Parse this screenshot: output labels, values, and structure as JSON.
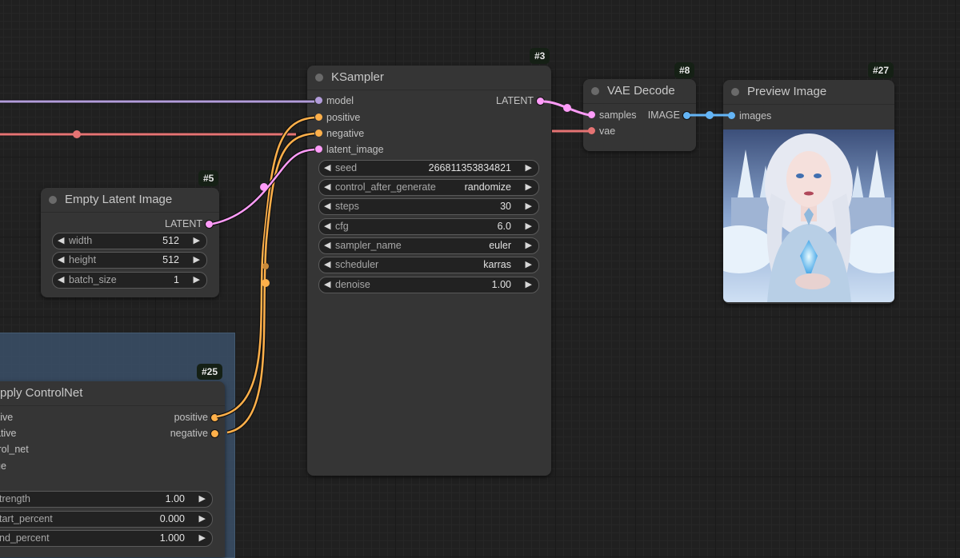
{
  "canvas": {
    "link_colors": {
      "model": "#b39ddb",
      "vae": "#ff6e6e",
      "conditioning": "#ffb04a",
      "latent": "#ff9cf9",
      "image": "#64b5f6"
    }
  },
  "nodes": {
    "ksampler": {
      "id_badge": "#3",
      "title": "KSampler",
      "inputs": [
        "model",
        "positive",
        "negative",
        "latent_image"
      ],
      "outputs": [
        "LATENT"
      ],
      "widgets": [
        {
          "label": "seed",
          "value": "266811353834821"
        },
        {
          "label": "control_after_generate",
          "value": "randomize"
        },
        {
          "label": "steps",
          "value": "30"
        },
        {
          "label": "cfg",
          "value": "6.0"
        },
        {
          "label": "sampler_name",
          "value": "euler"
        },
        {
          "label": "scheduler",
          "value": "karras"
        },
        {
          "label": "denoise",
          "value": "1.00"
        }
      ]
    },
    "vae_decode": {
      "id_badge": "#8",
      "title": "VAE Decode",
      "inputs": [
        "samples",
        "vae"
      ],
      "outputs": [
        "IMAGE"
      ]
    },
    "preview_image": {
      "id_badge": "#27",
      "title": "Preview Image",
      "inputs": [
        "images"
      ],
      "image_description": "Generated portrait of an ice queen with white braided hair in a frozen castle"
    },
    "empty_latent": {
      "id_badge": "#5",
      "title": "Empty Latent Image",
      "outputs": [
        "LATENT"
      ],
      "widgets": [
        {
          "label": "width",
          "value": "512"
        },
        {
          "label": "height",
          "value": "512"
        },
        {
          "label": "batch_size",
          "value": "1"
        }
      ]
    },
    "apply_controlnet": {
      "id_badge": "#25",
      "title": "Apply ControlNet",
      "title_visible": "pply ControlNet",
      "inputs_visible": [
        "itive",
        "ative",
        "trol_net",
        "ge"
      ],
      "outputs": [
        "positive",
        "negative"
      ],
      "widgets_visible": [
        {
          "label": "trength",
          "value": "1.00"
        },
        {
          "label": "tart_percent",
          "value": "0.000"
        },
        {
          "label": "nd_percent",
          "value": "1.000"
        }
      ]
    }
  }
}
